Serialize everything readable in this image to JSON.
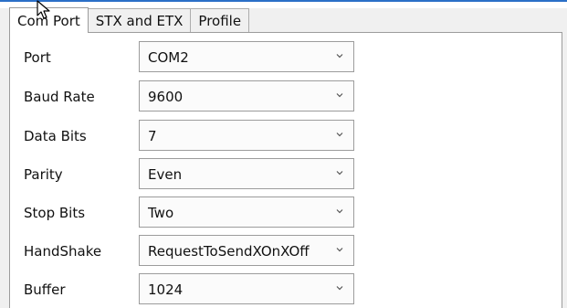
{
  "tabs": [
    "Com Port",
    "STX and ETX",
    "Profile"
  ],
  "settings": [
    {
      "label": "Port",
      "value": "COM2"
    },
    {
      "label": "Baud Rate",
      "value": "9600"
    },
    {
      "label": "Data Bits",
      "value": "7"
    },
    {
      "label": "Parity",
      "value": "Even"
    },
    {
      "label": "Stop Bits",
      "value": "Two"
    },
    {
      "label": "HandShake",
      "value": "RequestToSendXOnXOff"
    },
    {
      "label": "Buffer",
      "value": "1024"
    }
  ],
  "icons": {
    "dropdown": "chevron-down-icon",
    "cursor": "mouse-pointer-icon"
  },
  "colors": {
    "accent": "#2b6fc7",
    "border": "#9c9c9c"
  }
}
